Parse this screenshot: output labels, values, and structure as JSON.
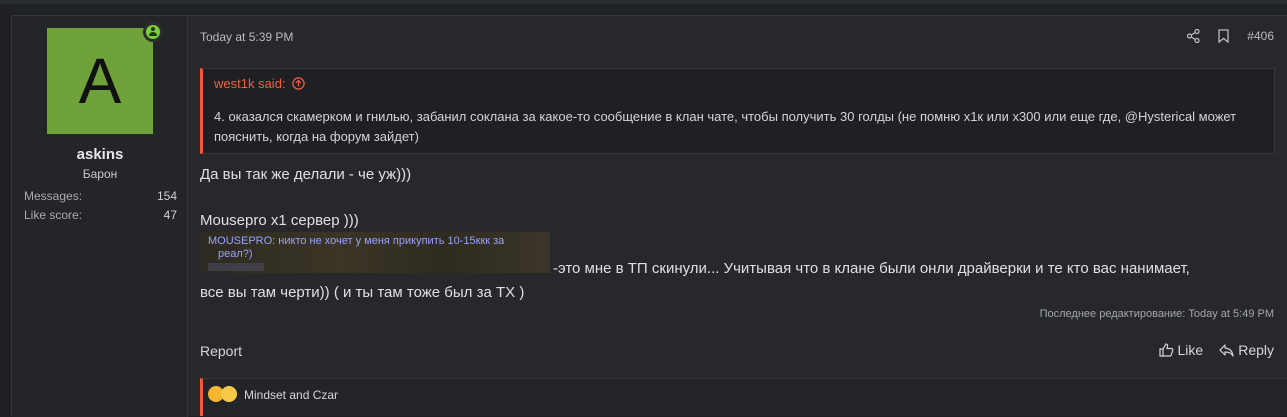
{
  "user": {
    "avatar_letter": "A",
    "avatar_color": "#6fa23a",
    "online_indicator": "online-user-icon",
    "username": "askins",
    "title": "Барон",
    "stats": [
      {
        "label": "Messages:",
        "value": "154"
      },
      {
        "label": "Like score:",
        "value": "47"
      }
    ]
  },
  "post": {
    "timestamp": "Today at 5:39 PM",
    "share_icon": "share-icon",
    "bookmark_icon": "bookmark-icon",
    "number": "#406",
    "quote": {
      "author": "west1k said:",
      "arrow_icon": "arrow-up-circle-icon",
      "accent_color": "#f05a3c",
      "text": "4. оказался скамерком и гнилью, забанил соклана за какое-то сообщение в клан чате, чтобы получить 30 голды (не помню х1к или х300 или еще где, @Hysterical может пояснить, когда на форум зайдет)"
    },
    "body_line1": "Да вы так же делали - че уж)))",
    "body_line2": "Mousepro x1 сервер )))",
    "image_text_1": "MOUSEPRO: никто не хочет у меня прикупить 10-15ккк за",
    "image_text_2": "реал?)",
    "body_line3": "-это мне в ТП скинули... Учитывая что в клане были онли драйверки и те кто вас нанимает,",
    "body_line4": "все вы там черти)) ( и ты там тоже был за ТХ )",
    "edited": "Последнее редактирование: Today at 5:49 PM",
    "report_label": "Report",
    "like_label": "Like",
    "reply_label": "Reply",
    "reactions_text": "Mindset and Czar"
  }
}
